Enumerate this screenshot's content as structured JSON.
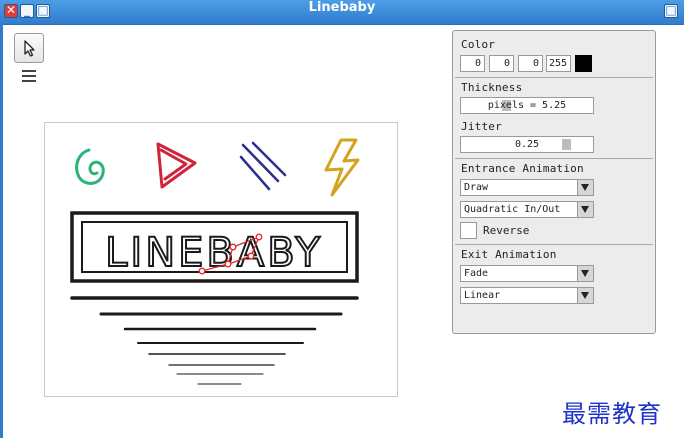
{
  "window": {
    "title": "Linebaby",
    "close_glyph": "✕",
    "minimize_glyph": "_",
    "maximize_glyph": "□",
    "restore_glyph": "□"
  },
  "toolbar": {
    "select_tool_icon": "cursor-arrow-icon",
    "menu_icon": "hamburger-menu-icon"
  },
  "canvas": {
    "logo_text": "LINEBABY",
    "stroke_colors": {
      "green": "#2bb37a",
      "red": "#d0243b",
      "blue": "#2a2f8f",
      "gold": "#d4a21e",
      "ink": "#1a1a1a",
      "selection": "#e02a2a"
    }
  },
  "panel": {
    "color": {
      "label": "Color",
      "r": "0",
      "g": "0",
      "b": "0",
      "a": "255",
      "swatch": "#000000"
    },
    "thickness": {
      "label": "Thickness",
      "value_text": "pixels = 5.25"
    },
    "jitter": {
      "label": "Jitter",
      "value_text": "0.25"
    },
    "entrance": {
      "label": "Entrance Animation",
      "type": "Draw",
      "easing": "Quadratic In/Out",
      "reverse_label": "Reverse",
      "reverse_checked": false
    },
    "exit": {
      "label": "Exit Animation",
      "type": "Fade",
      "easing": "Linear"
    }
  },
  "watermark": "最需教育"
}
